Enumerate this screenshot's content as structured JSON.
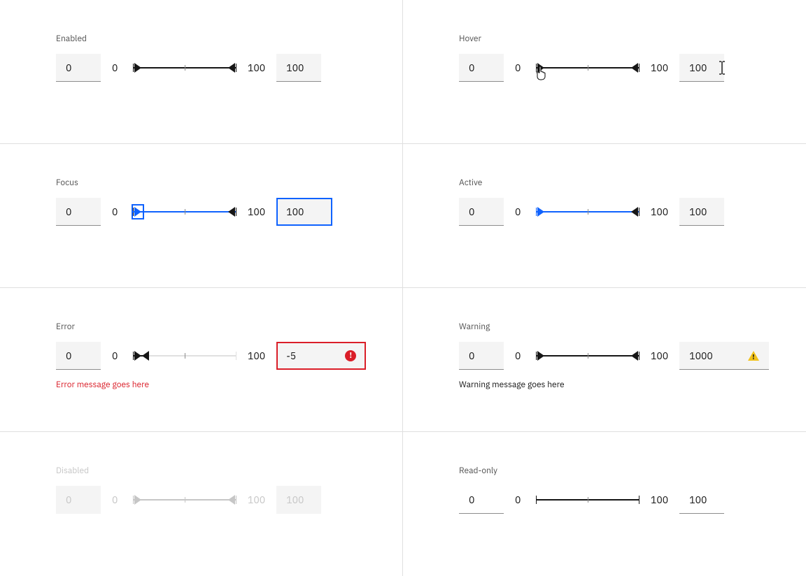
{
  "states": {
    "enabled": {
      "label": "Enabled",
      "min": "0",
      "max": "100",
      "lo_value": "0",
      "hi_value": "100"
    },
    "hover": {
      "label": "Hover",
      "min": "0",
      "max": "100",
      "lo_value": "0",
      "hi_value": "100"
    },
    "focus": {
      "label": "Focus",
      "min": "0",
      "max": "100",
      "lo_value": "0",
      "hi_value": "100"
    },
    "active": {
      "label": "Active",
      "min": "0",
      "max": "100",
      "lo_value": "0",
      "hi_value": "100"
    },
    "error": {
      "label": "Error",
      "min": "0",
      "max": "100",
      "lo_value": "0",
      "hi_value": "-5",
      "message": "Error message goes here"
    },
    "warning": {
      "label": "Warning",
      "min": "0",
      "max": "100",
      "lo_value": "0",
      "hi_value": "1000",
      "message": "Warning message goes here"
    },
    "disabled": {
      "label": "Disabled",
      "min": "0",
      "max": "100",
      "lo_value": "0",
      "hi_value": "100"
    },
    "readonly": {
      "label": "Read-only",
      "min": "0",
      "max": "100",
      "lo_value": "0",
      "hi_value": "100"
    }
  }
}
